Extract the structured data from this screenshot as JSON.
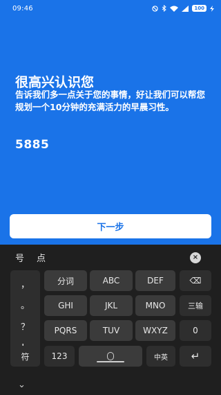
{
  "status_bar": {
    "time": "09:46",
    "battery": "100",
    "icons": [
      "dnd-icon",
      "bluetooth-icon",
      "wifi-icon",
      "signal-icon",
      "charging-icon"
    ]
  },
  "screen": {
    "headline": "很高兴认识您",
    "description": "告诉我们多一点关于您的事情，好让我们可以帮您规划一个10分钟的充满活力的早晨习性。",
    "typed_value": "5885",
    "next_button": "下一步"
  },
  "colors": {
    "app_background": "#1a73e8",
    "button_text": "#1a73e8",
    "keyboard_background": "#1f1f1f"
  },
  "keyboard": {
    "candidates": [
      "号",
      "点"
    ],
    "close_icon": "×",
    "punctuation": [
      "，",
      "。",
      "？",
      "！"
    ],
    "row1": [
      "分词",
      "ABC",
      "DEF"
    ],
    "backspace_icon": "⌫",
    "row2": [
      "GHI",
      "JKL",
      "MNO"
    ],
    "newline_label": "三输",
    "row3": [
      "PQRS",
      "TUV",
      "WXYZ"
    ],
    "zero": "0",
    "symbol_key": "符",
    "number_key": "123",
    "lang_key": "中英",
    "enter_icon": "↵",
    "hide_icon": "⌄"
  }
}
